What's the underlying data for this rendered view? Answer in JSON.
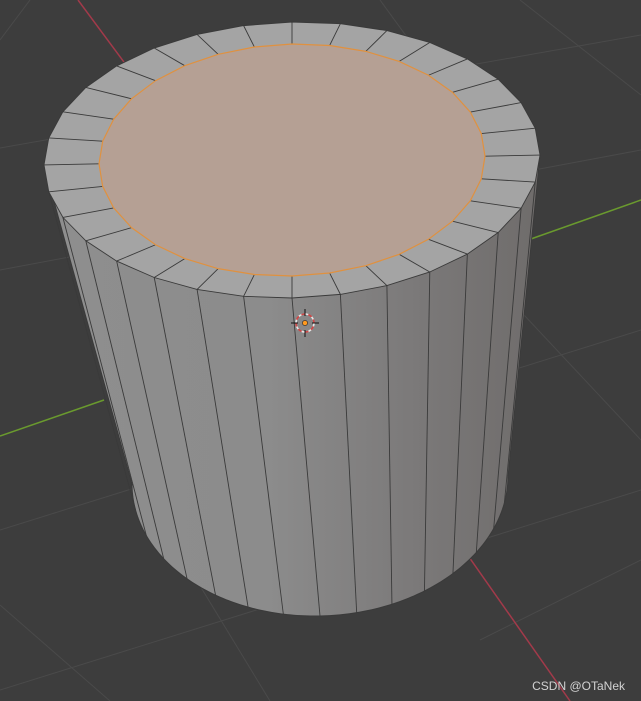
{
  "scene": {
    "object_type": "cylinder",
    "mode": "edit",
    "selected_face": "top-inset",
    "icons": [
      "3d-cursor-icon"
    ]
  },
  "colors": {
    "background": "#3d3d3d",
    "grid_line": "#525252",
    "x_axis": "#a23a4a",
    "y_axis": "#6a9a2e",
    "mesh_light": "#a4a4a4",
    "mesh_side": "#8a8a8a",
    "mesh_shadow": "#767473",
    "selected_face": "#b5a094",
    "selected_edge": "#e0913f",
    "wire": "#3a3a3a"
  },
  "watermark": {
    "text": "CSDN @OTaNek"
  }
}
